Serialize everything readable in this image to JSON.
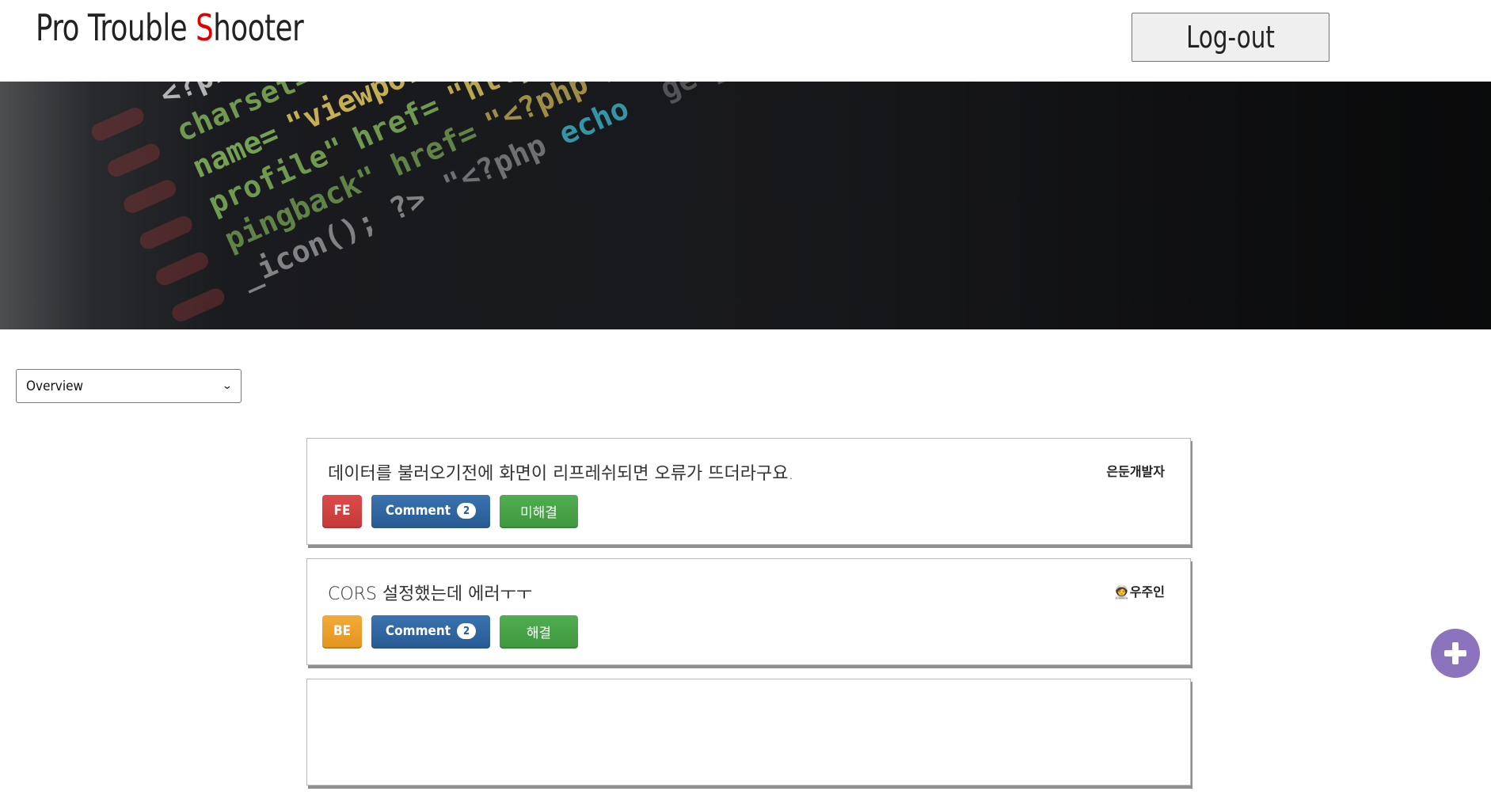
{
  "header": {
    "logo": {
      "part1": "Pro Trouble ",
      "accent_letter": "S",
      "part2": "hooter",
      "accent_color": "#e00000"
    },
    "logout_label": "Log-out"
  },
  "banner": {
    "description_icon": "code-editor-photo"
  },
  "filter": {
    "selected": "Overview"
  },
  "posts": [
    {
      "title": "데이터를 불러오기전에 화면이 리프레쉬되면 오류가 뜨더라구요.",
      "author": "은둔개발자",
      "category": "FE",
      "comment_label": "Comment",
      "comment_count": "2",
      "status": "미해결"
    },
    {
      "title": "CORS 설정했는데 에러ㅜㅜ",
      "author": "🧑‍🚀우주인",
      "category": "BE",
      "comment_label": "Comment",
      "comment_count": "2",
      "status": "해결"
    }
  ],
  "fab": {
    "icon": "plus-icon",
    "color": "#8b73bd"
  },
  "colors": {
    "fe": "#c63a3a",
    "be": "#e39620",
    "comment": "#285b93",
    "status": "#3f993f"
  }
}
